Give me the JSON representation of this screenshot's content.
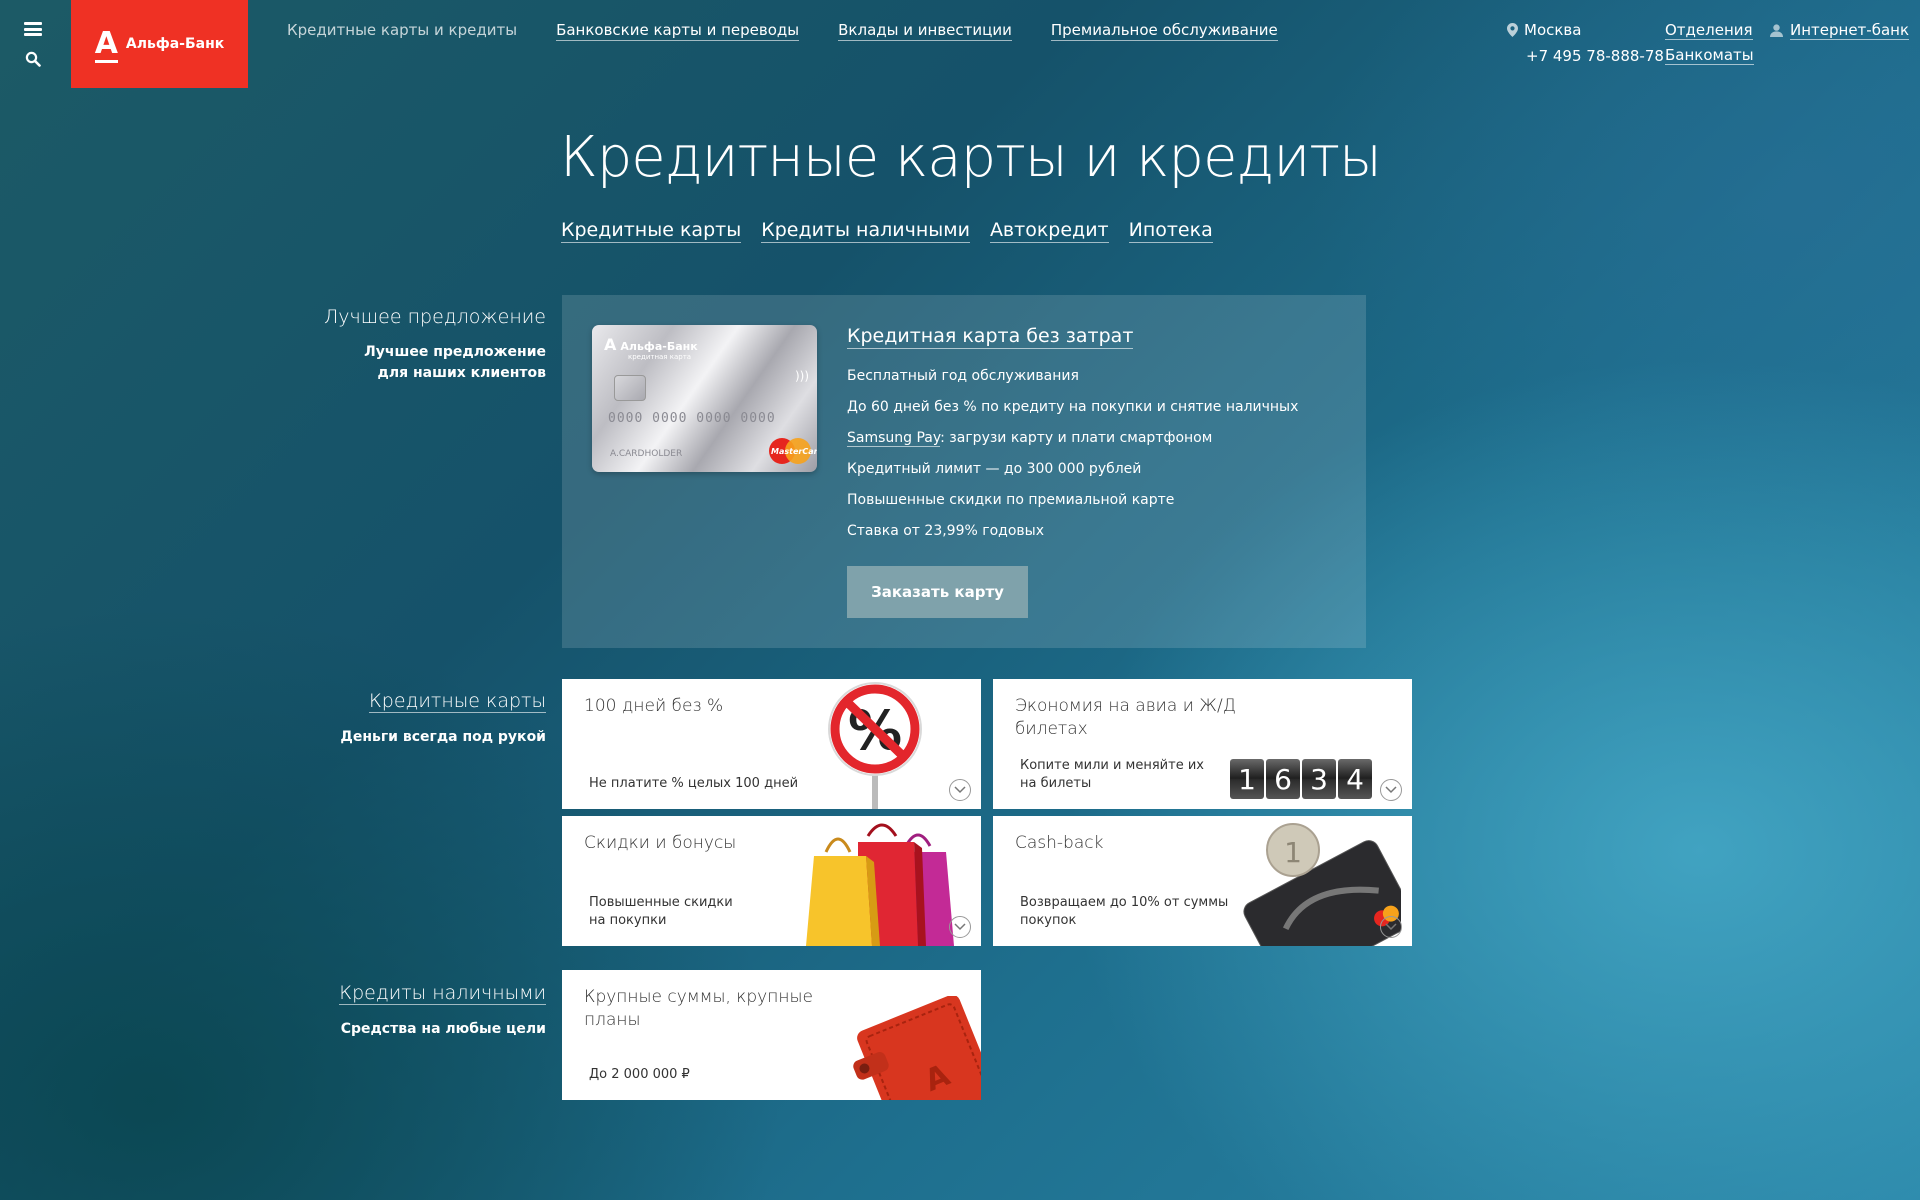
{
  "header": {
    "logo_text": "Альфа-Банк",
    "logo_letter": "А",
    "nav": [
      {
        "label": "Кредитные карты и кредиты",
        "active": true
      },
      {
        "label": "Банковские карты и переводы",
        "active": false
      },
      {
        "label": "Вклады и инвестиции",
        "active": false
      },
      {
        "label": "Премиальное обслуживание",
        "active": false
      }
    ],
    "city": "Москва",
    "phone": "+7 495 78-888-78",
    "offices": "Отделения",
    "atms": "Банкоматы",
    "internet_bank": "Интернет-банк"
  },
  "page": {
    "title": "Кредитные карты и кредиты",
    "subnav": [
      "Кредитные карты",
      "Кредиты наличными",
      "Автокредит",
      "Ипотека"
    ]
  },
  "best_offer": {
    "section_title": "Лучшее предложение",
    "section_sub_1": "Лучшее предложение",
    "section_sub_2": "для наших клиентов",
    "card_title": "Кредитная карта без затрат",
    "card_brand": "Альфа-Банк",
    "card_sub": "кредитная карта",
    "card_number": "0000 0000 0000 0000",
    "card_holder": "A.CARDHOLDER",
    "card_network": "MasterCard",
    "features": [
      "Бесплатный год обслуживания",
      "До 60 дней без % по кредиту на покупки и снятие наличных",
      "Кредитный лимит — до 300 000 рублей",
      "Повышенные скидки по премиальной карте",
      "Ставка от 23,99% годовых"
    ],
    "samsung_link": "Samsung Pay",
    "samsung_rest": ": загрузи карту и плати смартфоном",
    "button": "Заказать карту"
  },
  "credit_cards": {
    "section_title": "Кредитные карты",
    "section_sub": "Деньги всегда под рукой",
    "tiles": [
      {
        "title": "100 дней без %",
        "desc_1": "Не платите % целых 100 дней",
        "desc_2": ""
      },
      {
        "title": "Экономия на авиа и Ж/Д билетах",
        "desc_1": "Копите мили и меняйте их",
        "desc_2": "на билеты",
        "counter": [
          "1",
          "6",
          "3",
          "4"
        ]
      },
      {
        "title": "Скидки и бонусы",
        "desc_1": "Повышенные скидки",
        "desc_2": "на покупки"
      },
      {
        "title": "Cash-back",
        "desc_1": "Возвращаем до 10% от суммы",
        "desc_2": "покупок"
      }
    ]
  },
  "cash_loans": {
    "section_title": "Кредиты наличными",
    "section_sub": "Средства на любые цели",
    "tile": {
      "title": "Крупные суммы, крупные планы",
      "desc_1": "До 2 000 000 ₽"
    }
  },
  "colors": {
    "brand_red": "#ef3124",
    "button": "#7fa2ab"
  }
}
